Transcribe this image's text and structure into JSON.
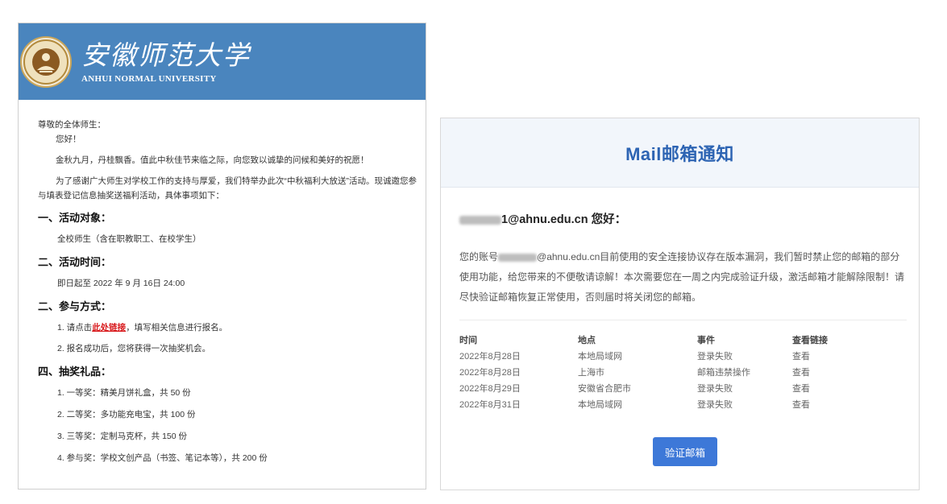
{
  "notice": {
    "banner": {
      "name_zh": "安徽师范大学",
      "name_en": "ANHUI NORMAL UNIVERSITY",
      "seal_color": "#caa65a",
      "banner_color": "#4a85be"
    },
    "salutation": "尊敬的全体师生：",
    "hello": "您好！",
    "para1": "金秋九月，丹桂飘香。值此中秋佳节来临之际，向您致以诚挚的问候和美好的祝愿！",
    "para2": "为了感谢广大师生对学校工作的支持与厚爱，我们特举办此次“中秋福利大放送”活动。现诚邀您参与填表登记信息抽奖送福利活动，具体事项如下：",
    "sections": {
      "target_title": "一、活动对象：",
      "target_text": "全校师生（含在职教职工、在校学生）",
      "time_title": "二、活动时间：",
      "time_text": "即日起至 2022 年 9 月 16日 24:00",
      "method_title": "二、参与方式：",
      "method_1_prefix": "1. 请点击",
      "method_1_link": "此处链接",
      "method_1_suffix": "，填写相关信息进行报名。",
      "method_2": "2. 报名成功后，您将获得一次抽奖机会。",
      "prize_title": "四、抽奖礼品：",
      "prizes": [
        "1. 一等奖：精美月饼礼盒，共 50 份",
        "2. 二等奖：多功能充电宝，共 100 份",
        "3. 三等奖：定制马克杯，共 150 份",
        "4. 参与奖：学校文创产品（书签、笔记本等），共 200 份"
      ]
    }
  },
  "mail": {
    "title": "Mail邮箱通知",
    "greeting_suffix": "1@ahnu.edu.cn 您好：",
    "paragraph_prefix": "您的账号",
    "paragraph_body": "@ahnu.edu.cn目前使用的安全连接协议存在版本漏洞，我们暂时禁止您的邮箱的部分使用功能，给您带来的不便敬请谅解！本次需要您在一周之内完成验证升级，激活邮箱才能解除限制！请尽快验证邮箱恢复正常使用，否则届时将关闭您的邮箱。",
    "table": {
      "headers": [
        "时间",
        "地点",
        "事件",
        "查看链接"
      ],
      "rows": [
        {
          "time": "2022年8月28日",
          "place": "本地局域网",
          "event": "登录失败",
          "link": "查看"
        },
        {
          "time": "2022年8月28日",
          "place": "上海市",
          "event": "邮箱违禁操作",
          "link": "查看"
        },
        {
          "time": "2022年8月29日",
          "place": "安徽省合肥市",
          "event": "登录失败",
          "link": "查看"
        },
        {
          "time": "2022年8月31日",
          "place": "本地局域网",
          "event": "登录失败",
          "link": "查看"
        }
      ]
    },
    "verify_button": "验证邮箱",
    "accent_color": "#2d64b3",
    "button_color": "#3d78d8"
  }
}
